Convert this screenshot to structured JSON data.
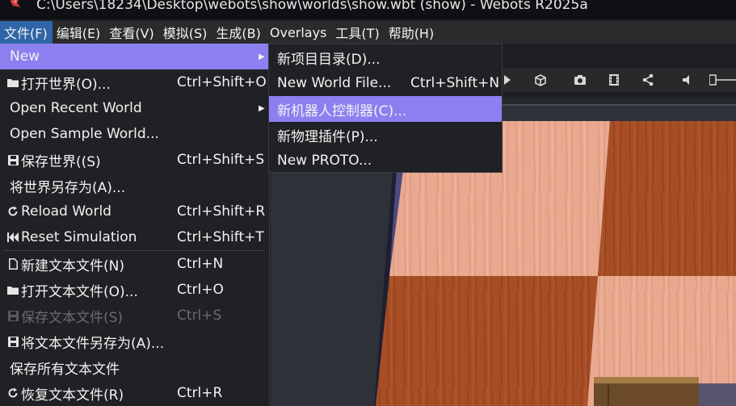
{
  "window": {
    "title": "C:\\Users\\18234\\Desktop\\webots\\show\\worlds\\show.wbt (show) - Webots R2025a"
  },
  "menubar": {
    "items": [
      {
        "label": "文件(F)",
        "active": true
      },
      {
        "label": "编辑(E)"
      },
      {
        "label": "查看(V)"
      },
      {
        "label": "模拟(S)"
      },
      {
        "label": "生成(B)"
      },
      {
        "label": "Overlays"
      },
      {
        "label": "工具(T)"
      },
      {
        "label": "帮助(H)"
      }
    ]
  },
  "file_menu": {
    "items": [
      {
        "label": "New",
        "icon": "",
        "shortcut": "",
        "submenu": true,
        "highlight": true
      },
      {
        "label": "打开世界(O)...",
        "icon": "folder-icon",
        "shortcut": "Ctrl+Shift+O"
      },
      {
        "label": "Open Recent World",
        "icon": "",
        "shortcut": "",
        "submenu": true
      },
      {
        "label": "Open Sample World...",
        "icon": "",
        "shortcut": ""
      },
      {
        "label": "保存世界((S)",
        "icon": "save-icon",
        "shortcut": "Ctrl+Shift+S"
      },
      {
        "label": "将世界另存为(A)...",
        "icon": "",
        "shortcut": ""
      },
      {
        "label": "Reload World",
        "icon": "reload-icon",
        "shortcut": "Ctrl+Shift+R"
      },
      {
        "label": "Reset Simulation",
        "icon": "reset-icon",
        "shortcut": "Ctrl+Shift+T"
      },
      {
        "label": "新建文本文件(N)",
        "icon": "file-icon",
        "shortcut": "Ctrl+N"
      },
      {
        "label": "打开文本文件(O)...",
        "icon": "folder-icon",
        "shortcut": "Ctrl+O"
      },
      {
        "label": "保存文本文件(S)",
        "icon": "save-icon",
        "shortcut": "Ctrl+S",
        "disabled": true
      },
      {
        "label": "将文本文件另存为(A)...",
        "icon": "save-icon",
        "shortcut": ""
      },
      {
        "label": "保存所有文本文件",
        "icon": "",
        "shortcut": ""
      },
      {
        "label": "恢复文本文件(R)",
        "icon": "reload-icon",
        "shortcut": "Ctrl+R"
      }
    ]
  },
  "new_submenu": {
    "items": [
      {
        "label": "新项目目录(D)...",
        "shortcut": ""
      },
      {
        "label": "New World File...",
        "shortcut": "Ctrl+Shift+N"
      },
      {
        "label": "新机器人控制器(C)...",
        "shortcut": "",
        "highlight": true
      },
      {
        "label": "新物理插件(P)...",
        "shortcut": ""
      },
      {
        "label": "New PROTO...",
        "shortcut": ""
      }
    ]
  },
  "toolbar": {
    "icons": [
      "play-icon",
      "view-cube-icon",
      "camera-icon",
      "film-icon",
      "share-icon",
      "volume-icon",
      "volume-slider"
    ]
  },
  "colors": {
    "menu_highlight": "#8c7ff0",
    "menubar_active": "#2f66a8",
    "menu_bg": "#202124"
  }
}
